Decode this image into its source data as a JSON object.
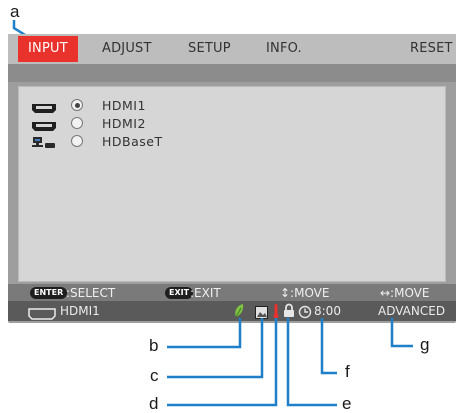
{
  "callouts": [
    "a",
    "b",
    "c",
    "d",
    "e",
    "f",
    "g"
  ],
  "menu": {
    "tabs": [
      "INPUT",
      "ADJUST",
      "SETUP",
      "INFO.",
      "RESET"
    ],
    "active_tab": "INPUT"
  },
  "sources": [
    {
      "label": "HDMI1",
      "icon": "hdmi-connector-icon",
      "selected": true
    },
    {
      "label": "HDMI2",
      "icon": "hdmi-connector-icon",
      "selected": false
    },
    {
      "label": "HDBaseT",
      "icon": "network-icon",
      "selected": false
    }
  ],
  "guide": {
    "enter_key": "ENTER",
    "select": ":SELECT",
    "exit_key": "EXIT",
    "exit": ":EXIT",
    "move_vertical": "↕:MOVE",
    "move_horizontal": "↔:MOVE"
  },
  "status": {
    "input": "HDMI1",
    "input_icon": "hdmi-connector-icon",
    "eco_icon": "leaf-icon",
    "picture_icon": "image-icon",
    "temp_icon": "thermometer-icon",
    "lock_icon": "lock-icon",
    "timer_icon": "clock-icon",
    "timer": "8:00",
    "menu_mode": "ADVANCED"
  },
  "colors": {
    "accent": "#e8322b",
    "callout_line": "#1f7fc9",
    "eco": "#7dc242",
    "temp": "#e8322b"
  }
}
